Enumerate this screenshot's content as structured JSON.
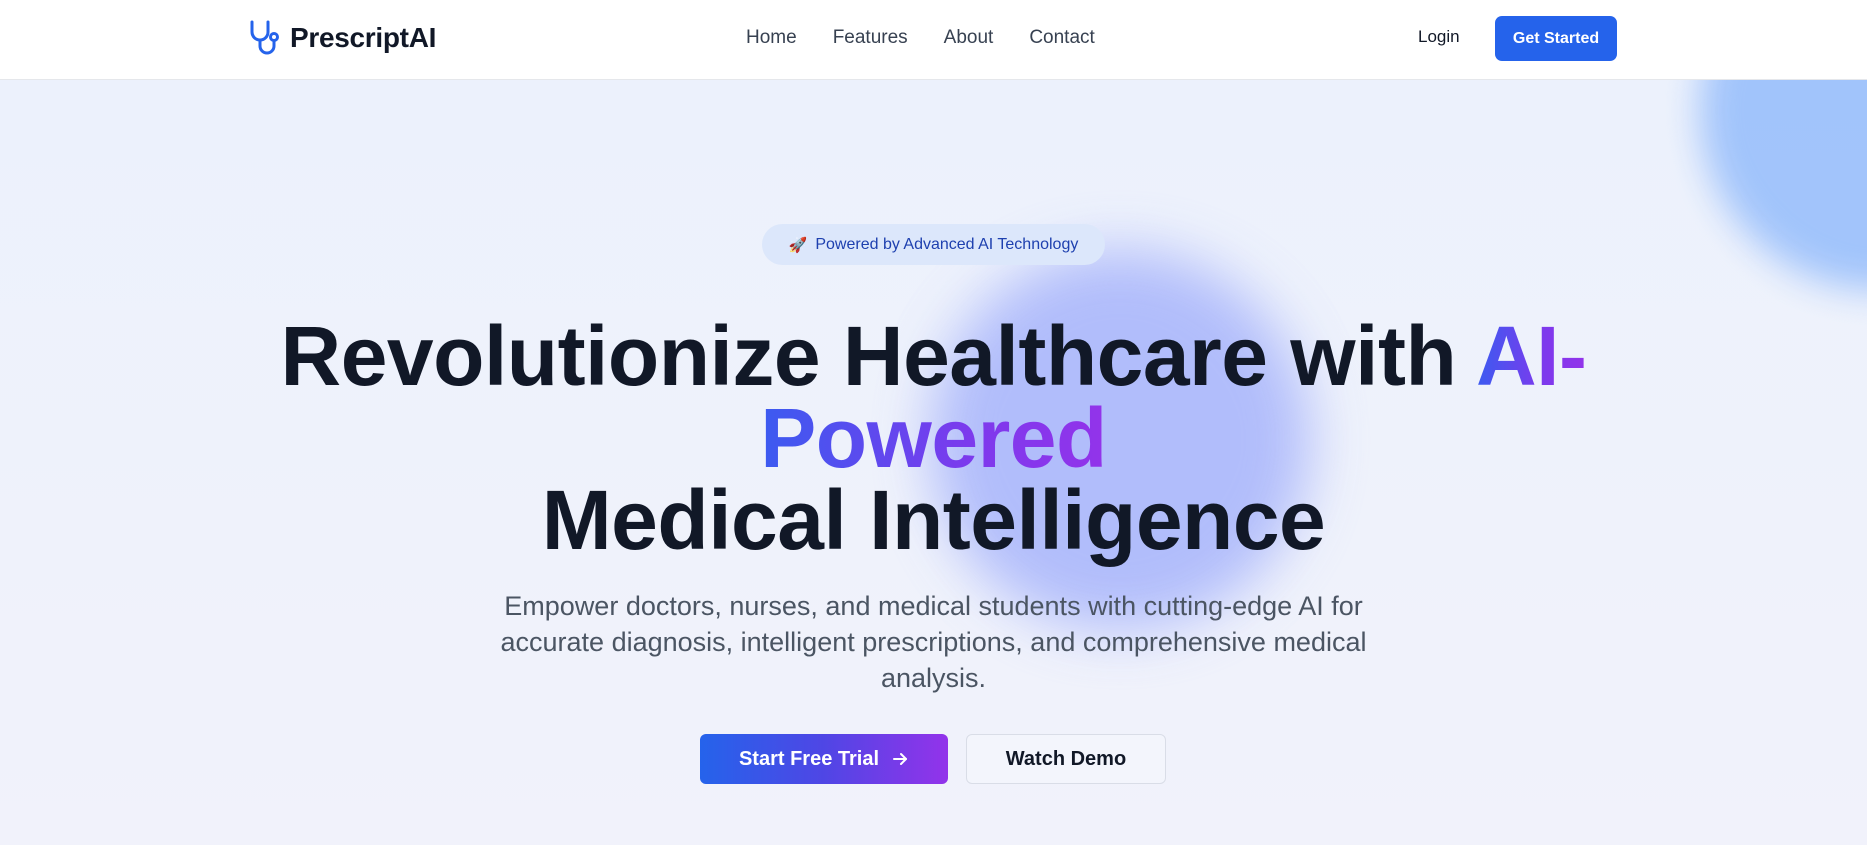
{
  "brand": {
    "name": "PrescriptAI",
    "logo_icon": "stethoscope-icon",
    "color": "#2563eb"
  },
  "nav": {
    "links": [
      "Home",
      "Features",
      "About",
      "Contact"
    ],
    "login_label": "Login",
    "get_started_label": "Get Started"
  },
  "hero": {
    "badge": {
      "icon": "rocket-icon",
      "text": "Powered by Advanced AI Technology"
    },
    "headline": {
      "line1_prefix": "Revolutionize Healthcare with ",
      "line1_highlight": "AI-",
      "line2_highlight": "Powered",
      "line3": "Medical Intelligence"
    },
    "subtitle": "Empower doctors, nurses, and medical students with cutting-edge AI for accurate diagnosis, intelligent prescriptions, and comprehensive medical analysis.",
    "primary_cta": "Start Free Trial",
    "primary_cta_icon": "arrow-right-icon",
    "secondary_cta": "Watch Demo"
  },
  "colors": {
    "accent_blue": "#2563eb",
    "accent_purple": "#9333ea",
    "heading": "#111827",
    "body_text": "#4b5563"
  }
}
